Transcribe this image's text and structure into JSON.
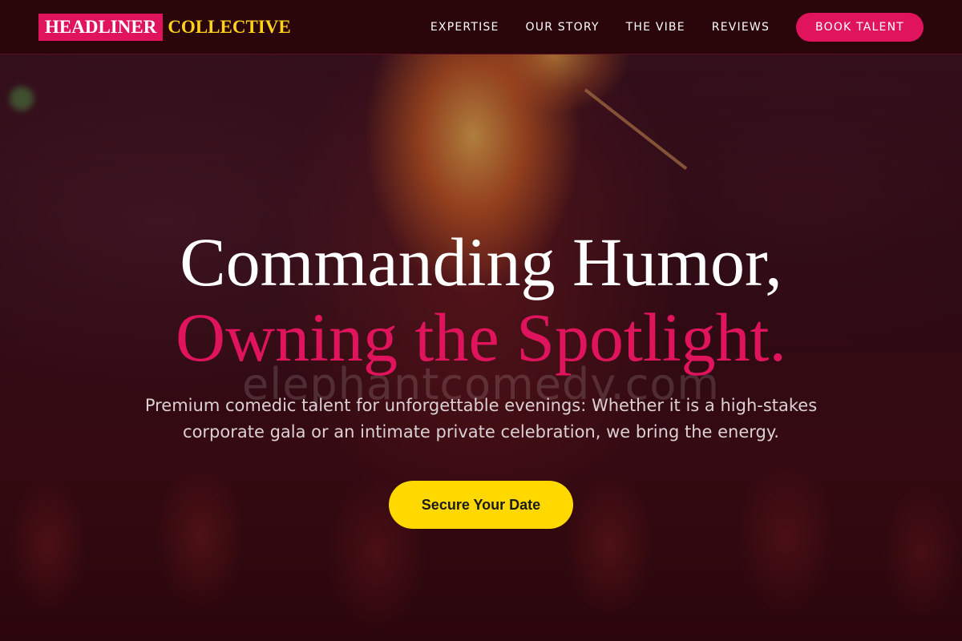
{
  "brand": {
    "primary": "HEADLINER",
    "secondary": "COLLECTIVE",
    "primary_bg_color": "#e0145c",
    "secondary_color": "#ffd21a"
  },
  "nav": {
    "links": [
      {
        "label": "EXPERTISE"
      },
      {
        "label": "OUR STORY"
      },
      {
        "label": "THE VIBE"
      },
      {
        "label": "REVIEWS"
      }
    ],
    "cta_label": "BOOK TALENT"
  },
  "hero": {
    "title_line1": "Commanding Humor,",
    "title_line2": "Owning the Spotlight.",
    "watermark": "elephantcomedy.com",
    "subtitle": "Premium comedic talent for unforgettable evenings: Whether it is a high-stakes corporate gala or an intimate private celebration, we bring the energy.",
    "cta_label": "Secure Your Date"
  },
  "colors": {
    "accent": "#e0145c",
    "cta": "#ffd800",
    "header_bg": "#2a0509"
  }
}
